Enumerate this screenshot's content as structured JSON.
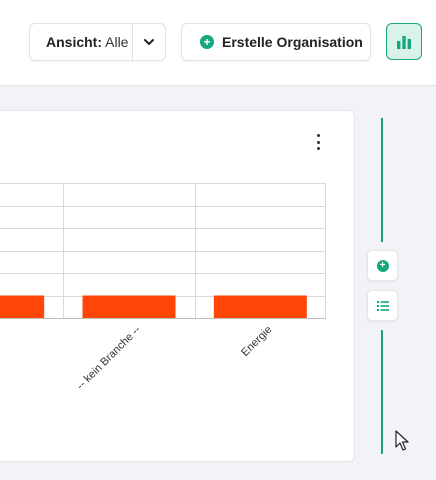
{
  "toolbar": {
    "view_label": "Ansicht:",
    "view_value": "Alle",
    "create_label": "Erstelle Organisation"
  },
  "colors": {
    "accent": "#16a77f",
    "bar": "#ff4507",
    "grid": "#d9d9d9"
  },
  "icons": {
    "dropdown": "chevron-down-icon",
    "create": "plus-circle-icon",
    "chart_toggle": "bar-chart-icon",
    "menu": "kebab-menu-icon",
    "rail_add": "plus-circle-icon",
    "rail_list": "list-icon",
    "cursor": "mouse-pointer-icon"
  },
  "chart_data": {
    "type": "bar",
    "categories": [
      "",
      "-- kein Branche --",
      "Energie"
    ],
    "values": [
      1,
      1,
      1
    ],
    "ylim": [
      0,
      6
    ],
    "grid": true
  }
}
